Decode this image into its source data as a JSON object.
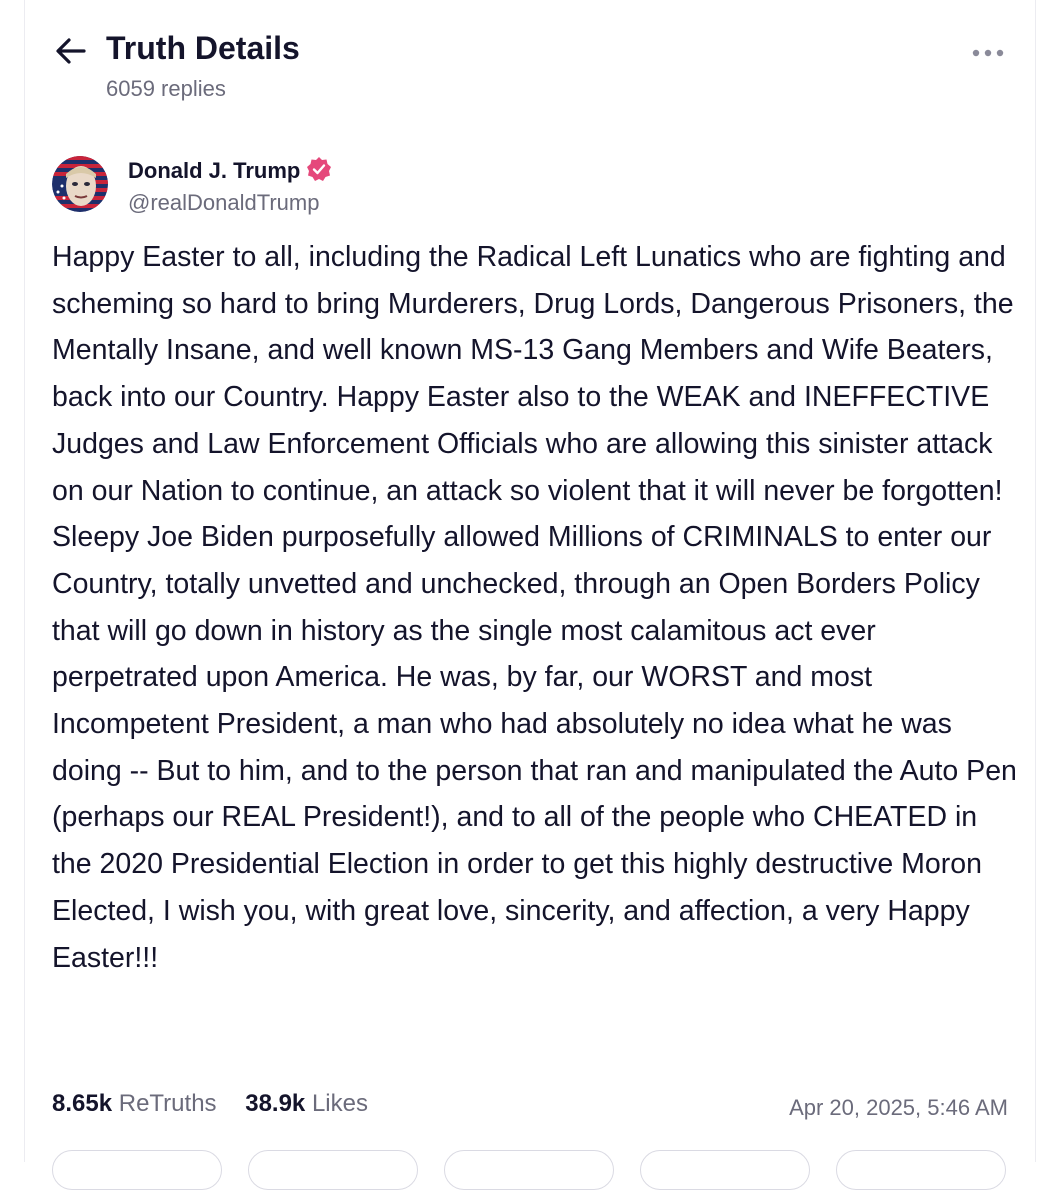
{
  "header": {
    "title": "Truth Details",
    "replies": "6059 replies"
  },
  "author": {
    "name": "Donald J. Trump",
    "handle": "@realDonaldTrump"
  },
  "post": {
    "text": "Happy Easter to all, including the Radical Left Lunatics who are fighting and scheming so hard to bring Murderers, Drug Lords, Dangerous Prisoners, the Mentally Insane, and well known MS-13 Gang Members and Wife Beaters, back into our Country. Happy Easter also to the WEAK and INEFFECTIVE Judges and Law Enforcement Officials who are allowing this sinister attack on our Nation to continue, an attack so violent that it will never be forgotten! Sleepy Joe Biden purposefully allowed Millions of CRIMINALS to enter our Country, totally unvetted and unchecked, through an Open Borders Policy that will go down in history as the single most calamitous act ever perpetrated upon America. He was, by far, our WORST and most Incompetent President, a man who had absolutely no idea what he was doing -- But to him, and to the person that ran and manipulated the Auto Pen (perhaps our REAL President!), and to all of the people who CHEATED in the 2020 Presidential Election in order to get this highly destructive Moron Elected, I wish you, with great love, sincerity, and affection, a very Happy Easter!!!"
  },
  "stats": {
    "retruths_count": "8.65k",
    "retruths_label": "ReTruths",
    "likes_count": "38.9k",
    "likes_label": "Likes"
  },
  "timestamp": "Apr 20, 2025, 5:46 AM",
  "icons": {
    "back": "arrow-left-icon",
    "more": "more-horizontal-icon",
    "verified": "verified-badge-icon"
  },
  "colors": {
    "text": "#14142b",
    "muted": "#6b6b7b",
    "verified": "#e5487b"
  }
}
